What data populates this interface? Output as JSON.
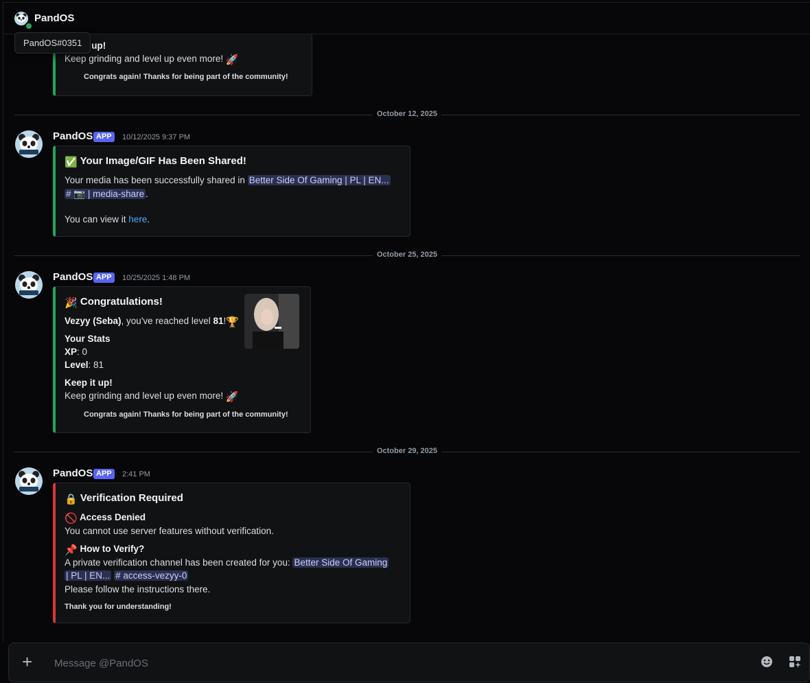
{
  "header": {
    "title": "PandOS",
    "tooltip": "PandOS#0351"
  },
  "first_embed": {
    "title_partial": "t up!",
    "line": "Keep grinding and level up even more!",
    "footer": "Congrats again! Thanks for being part of the community!"
  },
  "dividers": [
    "October 12, 2025",
    "October 25, 2025",
    "October 29, 2025"
  ],
  "messages": [
    {
      "author": "PandOS",
      "badge": "APP",
      "timestamp": "10/12/2025 9:37 PM",
      "embed": {
        "title": "Your Image/GIF Has Been Shared!",
        "line1_prefix": "Your media has been successfully shared in",
        "server_mention": "Better Side Of Gaming | PL | EN...",
        "channel_mention": "# 📷 | media-share",
        "view_prefix": "You can view it",
        "view_link": "here",
        "period": "."
      }
    },
    {
      "author": "PandOS",
      "badge": "APP",
      "timestamp": "10/25/2025 1:48 PM",
      "embed": {
        "title": "Congratulations!",
        "user": "Vezyy (Seba)",
        "reached": ", you've reached level",
        "level_bold": "81",
        "excl": "!",
        "stats_title": "Your Stats",
        "xp_label": "XP",
        "xp_value": ": 0",
        "level_label": "Level",
        "level_value": ": 81",
        "keep_title": "Keep it up!",
        "keep_line": "Keep grinding and level up even more!",
        "footer": "Congrats again! Thanks for being part of the community!"
      }
    },
    {
      "author": "PandOS",
      "badge": "APP",
      "timestamp": "2:41 PM",
      "embed": {
        "title": "Verification Required",
        "denied_title": "Access Denied",
        "denied_line": "You cannot use server features without verification.",
        "how_title": "How to Verify?",
        "how_line": "A private verification channel has been created for you:",
        "server_mention_a": "Better Side Of Gaming",
        "server_mention_b": "| PL | EN...",
        "channel_mention": "# access-vezyy-0",
        "follow_line": "Please follow the instructions there.",
        "footer": "Thank you for understanding!"
      }
    }
  ],
  "composer": {
    "placeholder": "Message @PandOS"
  },
  "colors": {
    "green": "#23a55a",
    "red": "#da373c",
    "blurple": "#5865f2",
    "link": "#4aa6ff"
  },
  "icons": [
    "plus-icon",
    "emoji-icon",
    "apps-icon",
    "rocket-icon",
    "check-icon",
    "party-icon",
    "trophy-icon",
    "lock-icon",
    "no-entry-icon",
    "pin-icon"
  ]
}
